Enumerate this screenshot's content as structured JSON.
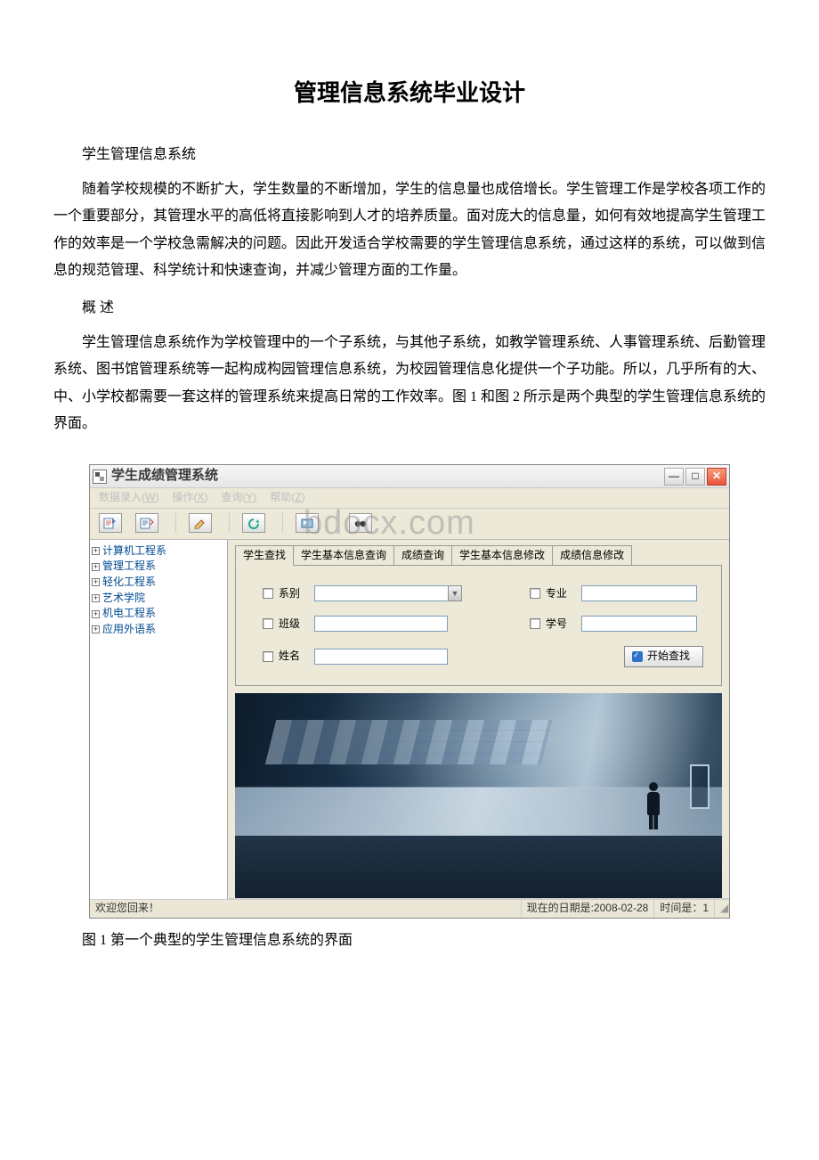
{
  "doc": {
    "title": "管理信息系统毕业设计",
    "section1_label": "学生管理信息系统",
    "para1": "随着学校规模的不断扩大，学生数量的不断增加，学生的信息量也成倍增长。学生管理工作是学校各项工作的一个重要部分，其管理水平的高低将直接影响到人才的培养质量。面对庞大的信息量，如何有效地提高学生管理工作的效率是一个学校急需解决的问题。因此开发适合学校需要的学生管理信息系统，通过这样的系统，可以做到信息的规范管理、科学统计和快速查询，并减少管理方面的工作量。",
    "section2_label": "概 述",
    "para2": "学生管理信息系统作为学校管理中的一个子系统，与其他子系统，如教学管理系统、人事管理系统、后勤管理系统、图书馆管理系统等一起构成构园管理信息系统，为校园管理信息化提供一个子功能。所以，几乎所有的大、中、小学校都需要一套这样的管理系统来提高日常的工作效率。图 1 和图 2 所示是两个典型的学生管理信息系统的界面。",
    "figure1_caption": "图 1 第一个典型的学生管理信息系统的界面"
  },
  "app": {
    "title": "学生成绩管理系统",
    "menubar": {
      "data": {
        "label": "数据录入",
        "mnemonic": "W"
      },
      "operate": {
        "label": "操作",
        "mnemonic": "X"
      },
      "query": {
        "label": "查询",
        "mnemonic": "Y"
      },
      "help": {
        "label": "帮助",
        "mnemonic": "Z"
      }
    },
    "watermark": "bdocx.com",
    "tree": {
      "items": [
        "计算机工程系",
        "管理工程系",
        "轻化工程系",
        "艺术学院",
        "机电工程系",
        "应用外语系"
      ]
    },
    "tabs": {
      "search": "学生查找",
      "basic_query": "学生基本信息查询",
      "score_query": "成绩查询",
      "basic_modify": "学生基本信息修改",
      "score_modify": "成绩信息修改",
      "active": "search"
    },
    "form": {
      "dept_label": "系别",
      "major_label": "专业",
      "class_label": "班级",
      "sid_label": "学号",
      "name_label": "姓名",
      "search_btn": "开始查找"
    },
    "statusbar": {
      "welcome": "欢迎您回来！",
      "date_label": "现在的日期是:2008-02-28",
      "time_label": "时间是：1"
    }
  }
}
